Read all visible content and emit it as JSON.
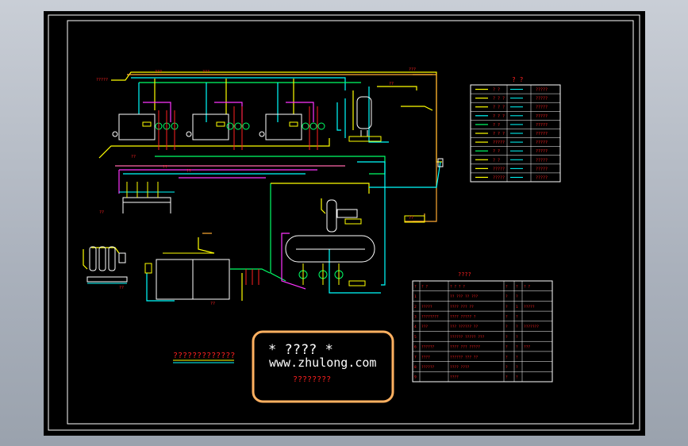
{
  "colors": {
    "background": "#000000",
    "frame": "#ffffff",
    "pipe_yellow": "#ffff00",
    "pipe_cyan": "#00ffff",
    "pipe_green": "#00ff66",
    "pipe_magenta": "#ff33ff",
    "pipe_orange": "#ffaa33",
    "pipe_pink": "#ff66aa",
    "text_red": "#ff2020",
    "stamp_border": "#ffb060",
    "stamp_text": "#ffffff"
  },
  "drawing_title": "?????????????",
  "legend": {
    "title": "? ?",
    "rows": [
      {
        "code": "? ?",
        "label": "?????"
      },
      {
        "code": "? ? ?",
        "label": "?????"
      },
      {
        "code": "? ? ?",
        "label": "?????"
      },
      {
        "code": "? ? ?",
        "label": "?????"
      },
      {
        "code": "? ?",
        "label": "?????"
      },
      {
        "code": "? ? ?",
        "label": "?????"
      },
      {
        "code": "?????",
        "label": "?????"
      },
      {
        "code": "? ?",
        "label": "?????"
      },
      {
        "code": "? ?",
        "label": "?????"
      },
      {
        "code": "?????",
        "label": "?????"
      },
      {
        "code": "?????",
        "label": "?????"
      }
    ]
  },
  "equipment_table": {
    "title": "????",
    "header": [
      "?",
      "? ?",
      "? ? ? ?",
      "?",
      "?",
      "? ?"
    ],
    "rows": [
      [
        "1",
        "",
        "?? ??? ?? ???",
        "?",
        "?",
        ""
      ],
      [
        "2",
        "?????",
        "???? ??? ??",
        "?",
        "1",
        "?????"
      ],
      [
        "3",
        "????????",
        "???? ????? ?",
        "?",
        "?",
        ""
      ],
      [
        "4",
        "???",
        "??? ?????? ??",
        "?",
        "?",
        "???????"
      ],
      [
        "5",
        "",
        "?????? ????? ???",
        "?",
        "?",
        ""
      ],
      [
        "6",
        "??????",
        "???? ??? ?????",
        "?",
        "?",
        "???"
      ],
      [
        "7",
        "????",
        "?????? ??? ??",
        "?",
        "?",
        ""
      ],
      [
        "8",
        "??????",
        "????  ????",
        "?",
        "?",
        ""
      ],
      [
        "9",
        "",
        "????",
        "?",
        "?",
        ""
      ]
    ]
  },
  "stamp": {
    "line1": "* ???? *",
    "line2": "www.zhulong.com",
    "line3": "????????"
  },
  "pipe_labels": [
    "?????",
    "???",
    "???",
    "???",
    "??",
    "??",
    "??",
    "??",
    "??",
    "??",
    "??",
    "??"
  ]
}
